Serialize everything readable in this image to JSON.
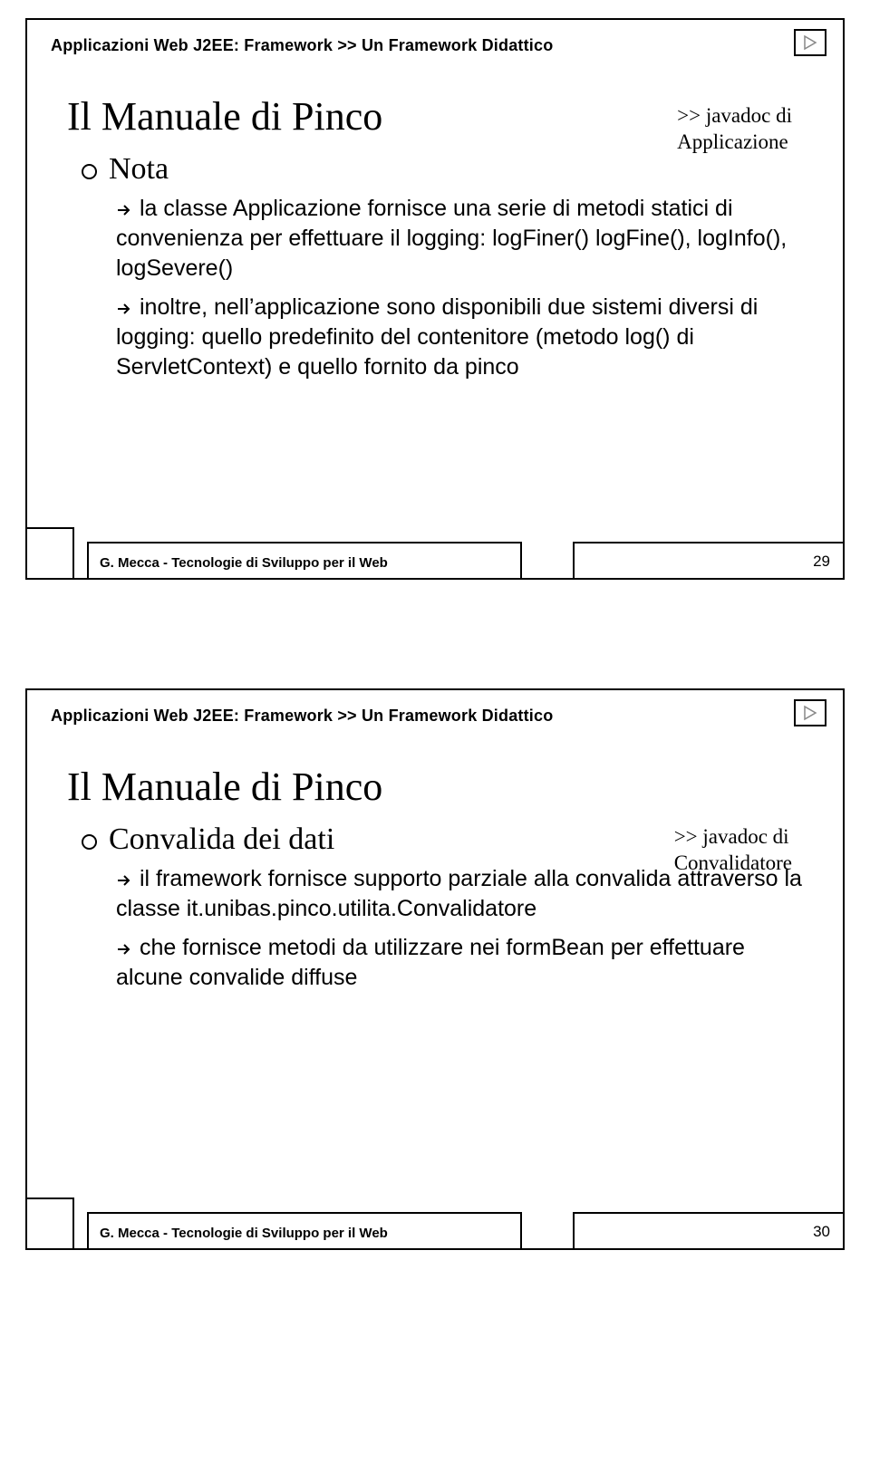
{
  "slides": [
    {
      "breadcrumb": "Applicazioni Web J2EE: Framework >> Un Framework Didattico",
      "title": "Il Manuale di Pinco",
      "right_note_l1": ">> javadoc di",
      "right_note_l2": "Applicazione",
      "l1_label": "Nota",
      "l2a": "la classe Applicazione fornisce una serie di metodi statici di convenienza per effettuare il logging: logFiner() logFine(), logInfo(), logSevere()",
      "l2b": "inoltre, nell’applicazione sono disponibili due sistemi diversi di logging: quello predefinito del contenitore (metodo log() di ServletContext) e quello fornito da pinco",
      "footer": "G. Mecca - Tecnologie di Sviluppo per il Web",
      "page": "29"
    },
    {
      "breadcrumb": "Applicazioni Web J2EE: Framework >> Un Framework Didattico",
      "title": "Il Manuale di Pinco",
      "right_note_l1": ">> javadoc di",
      "right_note_l2": "Convalidatore",
      "l1_label": "Convalida dei dati",
      "l2a": "il framework fornisce supporto parziale alla convalida attraverso la classe it.unibas.pinco.utilita.Convalidatore",
      "l2b": "che fornisce metodi da utilizzare nei formBean per effettuare alcune convalide diffuse",
      "footer": "G. Mecca - Tecnologie di Sviluppo per il Web",
      "page": "30"
    }
  ]
}
